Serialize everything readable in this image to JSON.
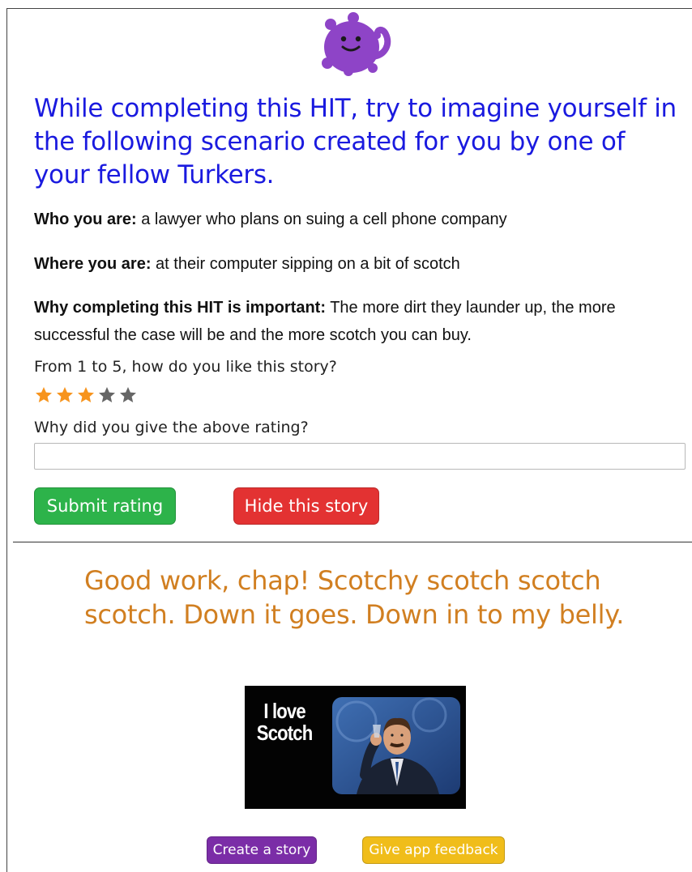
{
  "scenario": {
    "headline": "While completing this HIT, try to imagine yourself in the following scenario created for you by one of your fellow Turkers.",
    "who_label": "Who you are:",
    "who_value": " a lawyer who plans on suing a cell phone company",
    "where_label": "Where you are:",
    "where_value": " at their computer sipping on a bit of scotch",
    "why_label": "Why completing this HIT is important:",
    "why_value": " The more dirt they launder up, the more successful the case will be and the more scotch you can buy."
  },
  "rating": {
    "question": "From 1 to 5, how do you like this story?",
    "value": 3,
    "max": 5,
    "filled_color": "#f7941d",
    "empty_color": "#666666",
    "reason_question": "Why did you give the above rating?",
    "reason_value": ""
  },
  "actions": {
    "submit_label": "Submit rating",
    "hide_label": "Hide this story",
    "create_label": "Create a story",
    "feedback_label": "Give app feedback"
  },
  "reward": {
    "message": "Good work, chap! Scotchy scotch scotch scotch. Down it goes. Down in to my belly.",
    "gif_caption_line1": "I love",
    "gif_caption_line2": "Scotch"
  },
  "colors": {
    "headline": "#1a1adf",
    "praise": "#d17f21",
    "submit": "#2db34a",
    "hide": "#e33232",
    "create": "#7b2da7",
    "feedback": "#f0bd1a",
    "mascot": "#8e44c7"
  },
  "icons": {
    "mascot": "purple-blob-mascot-icon",
    "star": "star-icon"
  }
}
